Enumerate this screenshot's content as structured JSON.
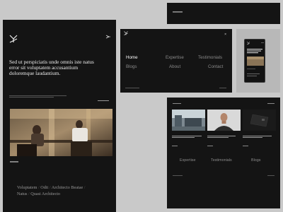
{
  "colors": {
    "page_bg": "#c9c9c9",
    "panel_bg": "#141414",
    "text_light": "#eeeeee",
    "text_muted": "#8a8a8a"
  },
  "left_panel": {
    "hero_title": "Sed ut perspiciatis unde omnis iste natus error sit voluptatem accusantium doloremque laudantium.",
    "footer_links": [
      "Voluptatem",
      "Odit",
      "Architecto Beatae",
      "Natus",
      "Quasi Architecto"
    ]
  },
  "menu_panel": {
    "items": {
      "home": "Home",
      "expertise": "Expertise",
      "testimonials": "Testimonials",
      "blogs": "Blogs",
      "about": "About",
      "contact": "Contact"
    },
    "close_glyph": "×"
  },
  "blog_panel": {
    "nav": {
      "expertise": "Expertise",
      "testimonials": "Testimonials",
      "blogs": "Blogs"
    }
  },
  "icons": [
    "logo-icon",
    "menu-icon",
    "close-icon"
  ]
}
